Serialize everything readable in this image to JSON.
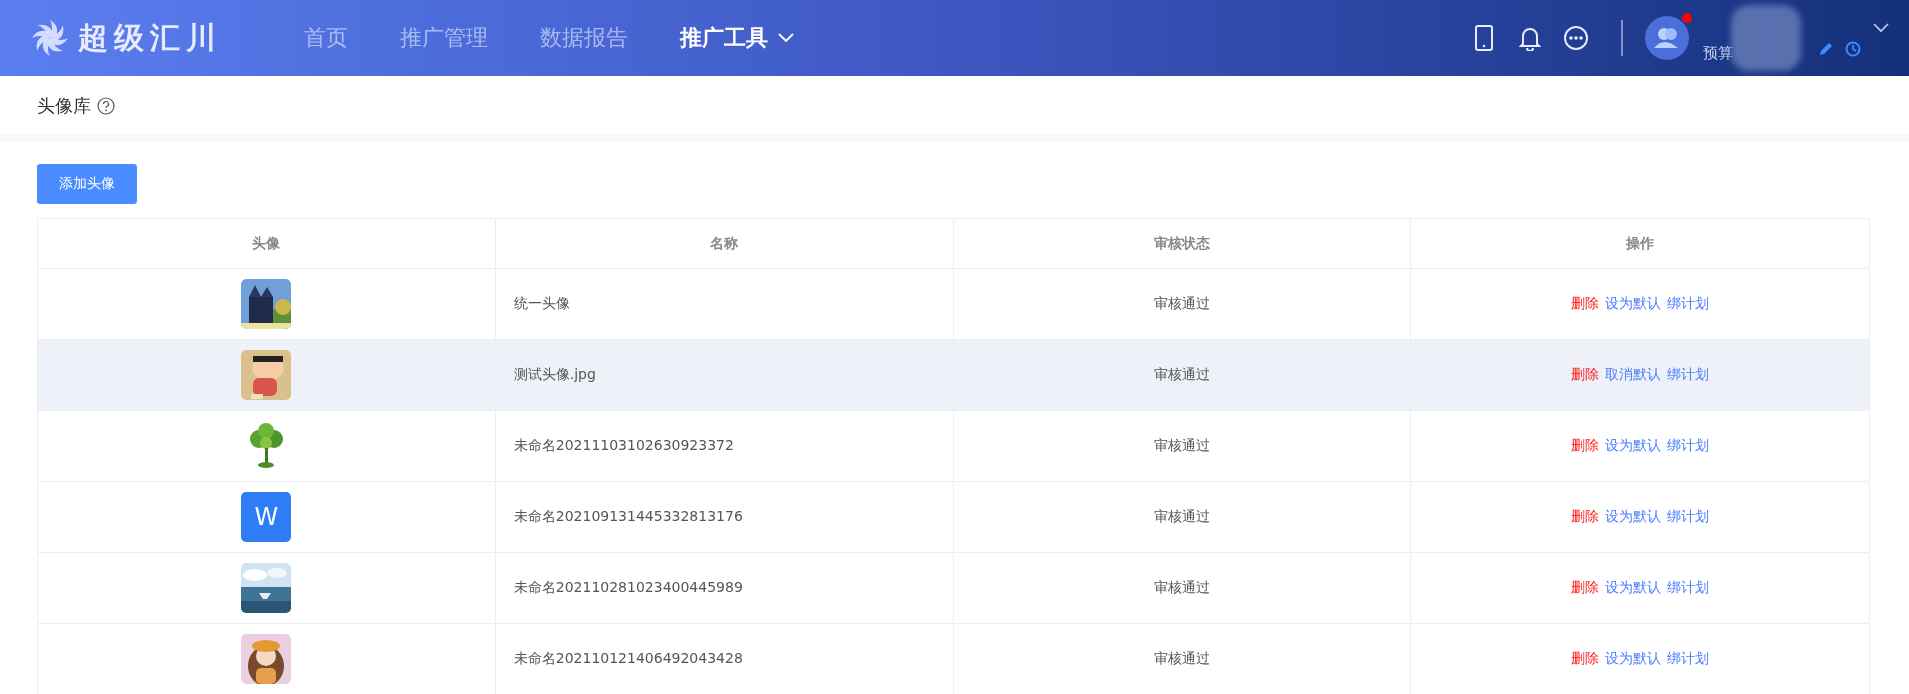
{
  "header": {
    "logo_text": "超级汇川",
    "nav": [
      {
        "label": "首页",
        "selected": false,
        "dropdown": false
      },
      {
        "label": "推广管理",
        "selected": false,
        "dropdown": false
      },
      {
        "label": "数据报告",
        "selected": false,
        "dropdown": false
      },
      {
        "label": "推广工具",
        "selected": true,
        "dropdown": true
      }
    ],
    "account": {
      "notification_dot": true,
      "budget_label": "预算"
    }
  },
  "page": {
    "title": "头像库",
    "add_button": "添加头像"
  },
  "table": {
    "columns": [
      "头像",
      "名称",
      "审核状态",
      "操作"
    ],
    "rows": [
      {
        "avatar": {
          "kind": "picture"
        },
        "name": "统一头像",
        "status": "审核通过",
        "highlighted": false,
        "actions": [
          {
            "label": "删除",
            "kind": "danger"
          },
          {
            "label": "设为默认",
            "kind": "link"
          },
          {
            "label": "绑计划",
            "kind": "link"
          }
        ]
      },
      {
        "avatar": {
          "kind": "picture"
        },
        "name": "测试头像.jpg",
        "status": "审核通过",
        "highlighted": true,
        "actions": [
          {
            "label": "删除",
            "kind": "danger"
          },
          {
            "label": "取消默认",
            "kind": "link"
          },
          {
            "label": "绑计划",
            "kind": "link"
          }
        ]
      },
      {
        "avatar": {
          "kind": "picture"
        },
        "name": "未命名20211103102630923372",
        "status": "审核通过",
        "highlighted": false,
        "actions": [
          {
            "label": "删除",
            "kind": "danger"
          },
          {
            "label": "设为默认",
            "kind": "link"
          },
          {
            "label": "绑计划",
            "kind": "link"
          }
        ]
      },
      {
        "avatar": {
          "kind": "letter",
          "text": "W"
        },
        "name": "未命名202109131445332813176",
        "status": "审核通过",
        "highlighted": false,
        "actions": [
          {
            "label": "删除",
            "kind": "danger"
          },
          {
            "label": "设为默认",
            "kind": "link"
          },
          {
            "label": "绑计划",
            "kind": "link"
          }
        ]
      },
      {
        "avatar": {
          "kind": "picture"
        },
        "name": "未命名202110281023400445989",
        "status": "审核通过",
        "highlighted": false,
        "actions": [
          {
            "label": "删除",
            "kind": "danger"
          },
          {
            "label": "设为默认",
            "kind": "link"
          },
          {
            "label": "绑计划",
            "kind": "link"
          }
        ]
      },
      {
        "avatar": {
          "kind": "picture"
        },
        "name": "未命名202110121406492043428",
        "status": "审核通过",
        "highlighted": false,
        "actions": [
          {
            "label": "删除",
            "kind": "danger"
          },
          {
            "label": "设为默认",
            "kind": "link"
          },
          {
            "label": "绑计划",
            "kind": "link"
          }
        ]
      }
    ]
  }
}
